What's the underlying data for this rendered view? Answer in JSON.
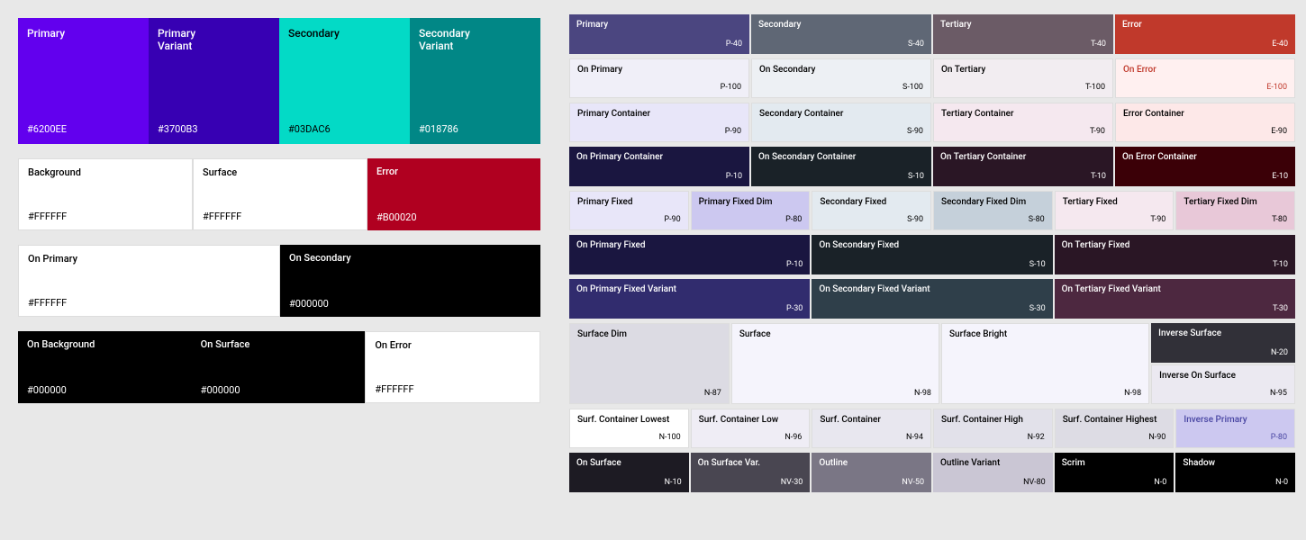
{
  "left": {
    "row1": [
      {
        "label": "Primary",
        "hex": "#6200EE",
        "bg": "#6200EE",
        "color": "#fff"
      },
      {
        "label": "Primary Variant",
        "hex": "#3700B3",
        "bg": "#3700B3",
        "color": "#fff"
      },
      {
        "label": "Secondary",
        "hex": "#03DAC6",
        "bg": "#03DAC6",
        "color": "#000"
      },
      {
        "label": "Secondary Variant",
        "hex": "#018786",
        "bg": "#018786",
        "color": "#fff"
      }
    ],
    "row2": [
      {
        "label": "Background",
        "hex": "#FFFFFF",
        "bg": "#FFFFFF",
        "color": "#000",
        "border": true
      },
      {
        "label": "Surface",
        "hex": "#FFFFFF",
        "bg": "#FFFFFF",
        "color": "#000",
        "border": true
      },
      {
        "label": "Error",
        "hex": "#B00020",
        "bg": "#B00020",
        "color": "#fff",
        "border": false
      }
    ],
    "row3": [
      {
        "label": "On Primary",
        "hex": "#FFFFFF",
        "bg": "#FFFFFF",
        "color": "#000",
        "border": true
      },
      {
        "label": "On Secondary",
        "hex": "#000000",
        "bg": "#000000",
        "color": "#fff",
        "border": false
      }
    ],
    "row4": [
      {
        "label": "On Background",
        "hex": "#000000",
        "bg": "#000000",
        "color": "#fff",
        "border": false
      },
      {
        "label": "On Surface",
        "hex": "#000000",
        "bg": "#000000",
        "color": "#fff",
        "border": false
      },
      {
        "label": "On Error",
        "hex": "#FFFFFF",
        "bg": "#FFFFFF",
        "color": "#000",
        "border": true
      }
    ]
  },
  "right": {
    "row1": [
      {
        "label": "Primary",
        "code": "P-40",
        "bg": "#4b4680",
        "color": "#fff"
      },
      {
        "label": "Secondary",
        "code": "S-40",
        "bg": "#5f6775",
        "color": "#fff"
      },
      {
        "label": "Tertiary",
        "code": "T-40",
        "bg": "#6b5b66",
        "color": "#fff"
      },
      {
        "label": "Error",
        "code": "E-40",
        "bg": "#c0392b",
        "color": "#fff"
      }
    ],
    "row2": [
      {
        "label": "On Primary",
        "code": "P-100",
        "bg": "#f0eff8",
        "color": "#000"
      },
      {
        "label": "On Secondary",
        "code": "S-100",
        "bg": "#edf0f4",
        "color": "#000"
      },
      {
        "label": "On Tertiary",
        "code": "T-100",
        "bg": "#f2edf1",
        "color": "#000"
      },
      {
        "label": "On Error",
        "code": "E-100",
        "bg": "#fff0f0",
        "color": "#c0392b"
      }
    ],
    "row3": [
      {
        "label": "Primary Container",
        "code": "P-90",
        "bg": "#e8e6f9",
        "color": "#000"
      },
      {
        "label": "Secondary Container",
        "code": "S-90",
        "bg": "#e3eaf0",
        "color": "#000"
      },
      {
        "label": "Tertiary Container",
        "code": "T-90",
        "bg": "#f5e8ef",
        "color": "#000"
      },
      {
        "label": "Error Container",
        "code": "E-90",
        "bg": "#fde8e8",
        "color": "#000"
      }
    ],
    "row4": [
      {
        "label": "On Primary Container",
        "code": "P-10",
        "bg": "#1a1640",
        "color": "#fff"
      },
      {
        "label": "On Secondary Container",
        "code": "S-10",
        "bg": "#1a2228",
        "color": "#fff"
      },
      {
        "label": "On Tertiary Container",
        "code": "T-10",
        "bg": "#2a1625",
        "color": "#fff"
      },
      {
        "label": "On Error Container",
        "code": "E-10",
        "bg": "#3b0007",
        "color": "#fff"
      }
    ],
    "row5": [
      {
        "label": "Primary Fixed",
        "code": "P-90",
        "bg": "#e8e6f9",
        "color": "#000"
      },
      {
        "label": "Primary Fixed Dim",
        "code": "P-80",
        "bg": "#ccc8f0",
        "color": "#000"
      },
      {
        "label": "Secondary Fixed",
        "code": "S-90",
        "bg": "#e3eaf0",
        "color": "#000"
      },
      {
        "label": "Secondary Fixed Dim",
        "code": "S-80",
        "bg": "#c5d0da",
        "color": "#000"
      },
      {
        "label": "Tertiary Fixed",
        "code": "T-90",
        "bg": "#f5e8ef",
        "color": "#000"
      },
      {
        "label": "Tertiary Fixed Dim",
        "code": "T-80",
        "bg": "#e8c8d8",
        "color": "#000"
      }
    ],
    "row6": [
      {
        "label": "On Primary Fixed",
        "code": "P-10",
        "bg": "#1a1640",
        "color": "#fff"
      },
      {
        "label": "On Secondary Fixed",
        "code": "S-10",
        "bg": "#1a2228",
        "color": "#fff"
      },
      {
        "label": "On Tertiary Fixed",
        "code": "T-10",
        "bg": "#2a1625",
        "color": "#fff"
      }
    ],
    "row7": [
      {
        "label": "On Primary Fixed Variant",
        "code": "P-30",
        "bg": "#312c6e",
        "color": "#fff"
      },
      {
        "label": "On Secondary Fixed Variant",
        "code": "S-30",
        "bg": "#2f3f4a",
        "color": "#fff"
      },
      {
        "label": "On Tertiary Fixed Variant",
        "code": "T-30",
        "bg": "#4d2840",
        "color": "#fff"
      }
    ],
    "row8": [
      {
        "label": "Surface Dim",
        "code": "N-87",
        "bg": "#dcdbe3",
        "color": "#000"
      },
      {
        "label": "Surface",
        "code": "N-98",
        "bg": "#f5f4fc",
        "color": "#000"
      },
      {
        "label": "Surface Bright",
        "code": "N-98",
        "bg": "#f5f4fc",
        "color": "#000"
      },
      {
        "label": "Inverse Surface",
        "code": "N-20",
        "bg": "#313038",
        "color": "#fff"
      }
    ],
    "row8b": [
      {
        "label": "",
        "code": "",
        "bg": "transparent"
      },
      {
        "label": "",
        "code": "",
        "bg": "transparent"
      },
      {
        "label": "Inverse On Surface",
        "code": "N-95",
        "bg": "#ebe9f1",
        "color": "#000"
      }
    ],
    "row9": [
      {
        "label": "Surf. Container Lowest",
        "code": "N-100",
        "bg": "#ffffff",
        "color": "#000",
        "border": true
      },
      {
        "label": "Surf. Container Low",
        "code": "N-96",
        "bg": "#efedf5",
        "color": "#000"
      },
      {
        "label": "Surf. Container",
        "code": "N-94",
        "bg": "#e8e7ef",
        "color": "#000"
      },
      {
        "label": "Surf. Container High",
        "code": "N-92",
        "bg": "#e2e1ea",
        "color": "#000"
      },
      {
        "label": "Surf. Container Highest",
        "code": "N-90",
        "bg": "#dddce4",
        "color": "#000"
      },
      {
        "label": "Inverse Primary",
        "code": "P-80",
        "bg": "#ccc8f0",
        "color": "#000",
        "accent": "#7c77d1"
      }
    ],
    "row10": [
      {
        "label": "On Surface",
        "code": "N-10",
        "bg": "#1d1b23",
        "color": "#fff"
      },
      {
        "label": "On Surface Var.",
        "code": "NV-30",
        "bg": "#494651",
        "color": "#fff"
      },
      {
        "label": "Outline",
        "code": "NV-50",
        "bg": "#7a7685",
        "color": "#fff"
      },
      {
        "label": "Outline Variant",
        "code": "NV-80",
        "bg": "#cac6d4",
        "color": "#000"
      },
      {
        "label": "Scrim",
        "code": "N-0",
        "bg": "#000000",
        "color": "#fff"
      },
      {
        "label": "Shadow",
        "code": "N-0",
        "bg": "#000000",
        "color": "#fff"
      }
    ]
  }
}
